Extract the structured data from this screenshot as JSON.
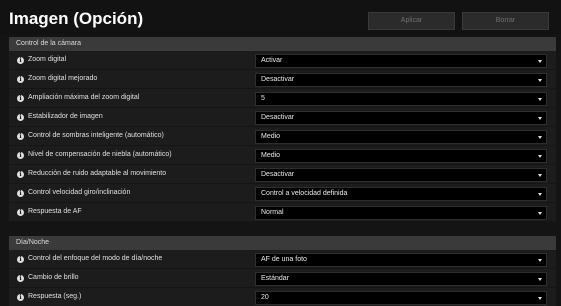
{
  "header": {
    "title": "Imagen (Opción)",
    "apply_label": "Aplicar",
    "clear_label": "Borrar"
  },
  "sections": [
    {
      "title": "Control de la cámara",
      "rows": [
        {
          "label": "Zoom digital",
          "value": "Activar"
        },
        {
          "label": "Zoom digital mejorado",
          "value": "Desactivar"
        },
        {
          "label": "Ampliación máxima del zoom digital",
          "value": "5"
        },
        {
          "label": "Estabilizador de imagen",
          "value": "Desactivar"
        },
        {
          "label": "Control de sombras inteligente (automático)",
          "value": "Medio"
        },
        {
          "label": "Nivel de compensación de niebla (automático)",
          "value": "Medio"
        },
        {
          "label": "Reducción de ruido adaptable al movimiento",
          "value": "Desactivar"
        },
        {
          "label": "Control velocidad giro/inclinación",
          "value": "Control a velocidad definida"
        },
        {
          "label": "Respuesta de AF",
          "value": "Normal"
        }
      ]
    },
    {
      "title": "Día/Noche",
      "rows": [
        {
          "label": "Control del enfoque del modo de día/noche",
          "value": "AF de una foto"
        },
        {
          "label": "Cambio de brillo",
          "value": "Estándar"
        },
        {
          "label": "Respuesta (seg.)",
          "value": "20"
        }
      ]
    }
  ],
  "icons": {
    "info": "info-icon",
    "dropdown": "chevron-down-icon"
  },
  "colors": {
    "background": "#141414",
    "section_header": "#3a3a3a",
    "select_bg": "#000000"
  }
}
